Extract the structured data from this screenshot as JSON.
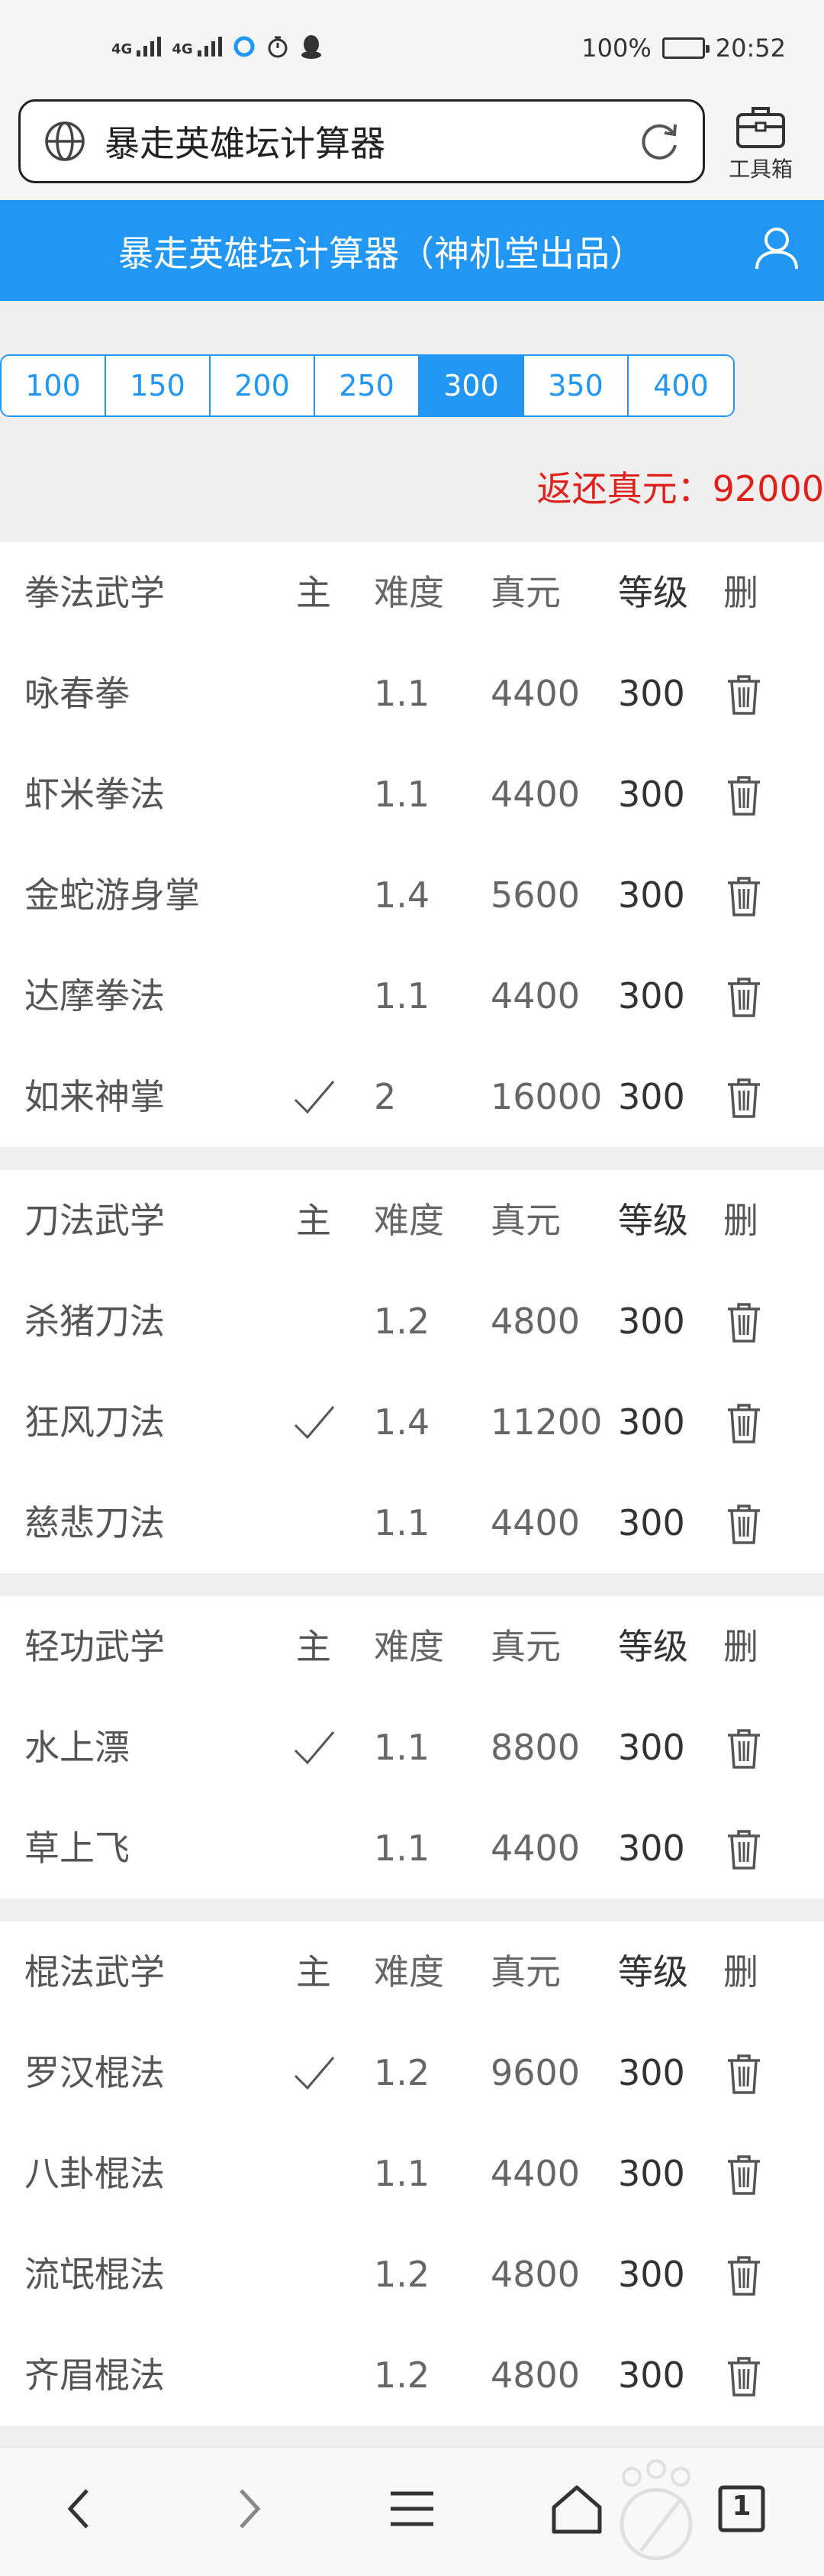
{
  "status": {
    "signal1_label": "4G",
    "signal2_label": "4G",
    "battery": "100%",
    "time": "20:52"
  },
  "browser": {
    "url_text": "暴走英雄坛计算器",
    "toolbox_label": "工具箱"
  },
  "header": {
    "title": "暴走英雄坛计算器（神机堂出品）"
  },
  "levels": {
    "options": [
      "100",
      "150",
      "200",
      "250",
      "300",
      "350",
      "400"
    ],
    "selected": "300"
  },
  "refund": {
    "label": "返还真元：",
    "value": "92000"
  },
  "sections": [
    {
      "headers": [
        "拳法武学",
        "主",
        "难度",
        "真元",
        "等级",
        "删"
      ],
      "rows": [
        {
          "name": "咏春拳",
          "main": false,
          "difficulty": "1.1",
          "zhenyuan": "4400",
          "level": "300"
        },
        {
          "name": "虾米拳法",
          "main": false,
          "difficulty": "1.1",
          "zhenyuan": "4400",
          "level": "300"
        },
        {
          "name": "金蛇游身掌",
          "main": false,
          "difficulty": "1.4",
          "zhenyuan": "5600",
          "level": "300"
        },
        {
          "name": "达摩拳法",
          "main": false,
          "difficulty": "1.1",
          "zhenyuan": "4400",
          "level": "300"
        },
        {
          "name": "如来神掌",
          "main": true,
          "difficulty": "2",
          "zhenyuan": "16000",
          "level": "300"
        }
      ]
    },
    {
      "headers": [
        "刀法武学",
        "主",
        "难度",
        "真元",
        "等级",
        "删"
      ],
      "rows": [
        {
          "name": "杀猪刀法",
          "main": false,
          "difficulty": "1.2",
          "zhenyuan": "4800",
          "level": "300"
        },
        {
          "name": "狂风刀法",
          "main": true,
          "difficulty": "1.4",
          "zhenyuan": "11200",
          "level": "300"
        },
        {
          "name": "慈悲刀法",
          "main": false,
          "difficulty": "1.1",
          "zhenyuan": "4400",
          "level": "300"
        }
      ]
    },
    {
      "headers": [
        "轻功武学",
        "主",
        "难度",
        "真元",
        "等级",
        "删"
      ],
      "rows": [
        {
          "name": "水上漂",
          "main": true,
          "difficulty": "1.1",
          "zhenyuan": "8800",
          "level": "300"
        },
        {
          "name": "草上飞",
          "main": false,
          "difficulty": "1.1",
          "zhenyuan": "4400",
          "level": "300"
        }
      ]
    },
    {
      "headers": [
        "棍法武学",
        "主",
        "难度",
        "真元",
        "等级",
        "删"
      ],
      "rows": [
        {
          "name": "罗汉棍法",
          "main": true,
          "difficulty": "1.2",
          "zhenyuan": "9600",
          "level": "300"
        },
        {
          "name": "八卦棍法",
          "main": false,
          "difficulty": "1.1",
          "zhenyuan": "4400",
          "level": "300"
        },
        {
          "name": "流氓棍法",
          "main": false,
          "difficulty": "1.2",
          "zhenyuan": "4800",
          "level": "300"
        },
        {
          "name": "齐眉棍法",
          "main": false,
          "difficulty": "1.2",
          "zhenyuan": "4800",
          "level": "300"
        }
      ]
    }
  ],
  "bottom_nav": {
    "tab_count": "1",
    "icons": [
      "back-icon",
      "forward-icon",
      "menu-icon",
      "home-icon",
      "tabs-icon"
    ]
  },
  "colors": {
    "accent": "#2196f3",
    "refund": "#e0201a",
    "background": "#efefef"
  }
}
